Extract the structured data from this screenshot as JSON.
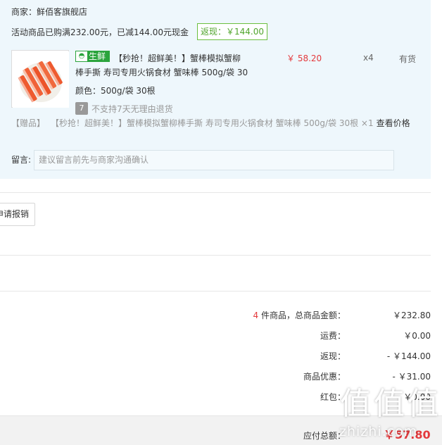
{
  "order": {
    "merchant": "商家：鲜佰客旗舰店",
    "promo": "活动商品已购满232.00元，已减144.00元现金",
    "cashback_tag": "返现：￥144.00"
  },
  "product": {
    "badge_label": "生鲜",
    "badge_icon": "fish-icon",
    "title_line1": "【秒抢！超鲜美！】蟹棒模拟蟹柳",
    "title_line2": "棒手撕 寿司专用火锅食材 蟹味棒 500g/袋 30",
    "price": "￥ 58.20",
    "quantity": "x4",
    "stock": "有货",
    "spec": "颜色：500g/袋 30根",
    "no_return_icon": "7",
    "no_return_text": "不支持7天无理由退货"
  },
  "gift": {
    "label": "【赠品】",
    "text": "【秒抢！超鲜美！】蟹棒模拟蟹柳棒手撕 寿司专用火锅食材 蟹味棒 500g/袋 30根 ×1",
    "link": "查看价格"
  },
  "message": {
    "label": "留言:",
    "placeholder": "建议留言前先与商家沟通确认"
  },
  "reimburse_button": "申请报销",
  "summary": {
    "count": "4",
    "count_suffix": " 件商品，总商品金额：",
    "total_amount": "￥232.80",
    "shipping_label": "运费：",
    "shipping_value": "￥0.00",
    "cashback_label": "返现：",
    "cashback_value": "- ￥144.00",
    "discount_label": "商品优惠：",
    "discount_value": "- ￥31.00",
    "redpacket_label": "红包：",
    "redpacket_value": "- ￥0.00"
  },
  "payment": {
    "label": "应付总额：",
    "value": "￥57.80"
  },
  "watermark": {
    "chars": [
      "值",
      "值",
      "值"
    ],
    "text": "zhizhi.com"
  },
  "colors": {
    "panel_bg": "#eef7fc",
    "price_red": "#e4393c",
    "cashback_green": "#4fa42b",
    "fresh_green": "#2aa43c",
    "footer_bg": "#f2f2f2"
  }
}
